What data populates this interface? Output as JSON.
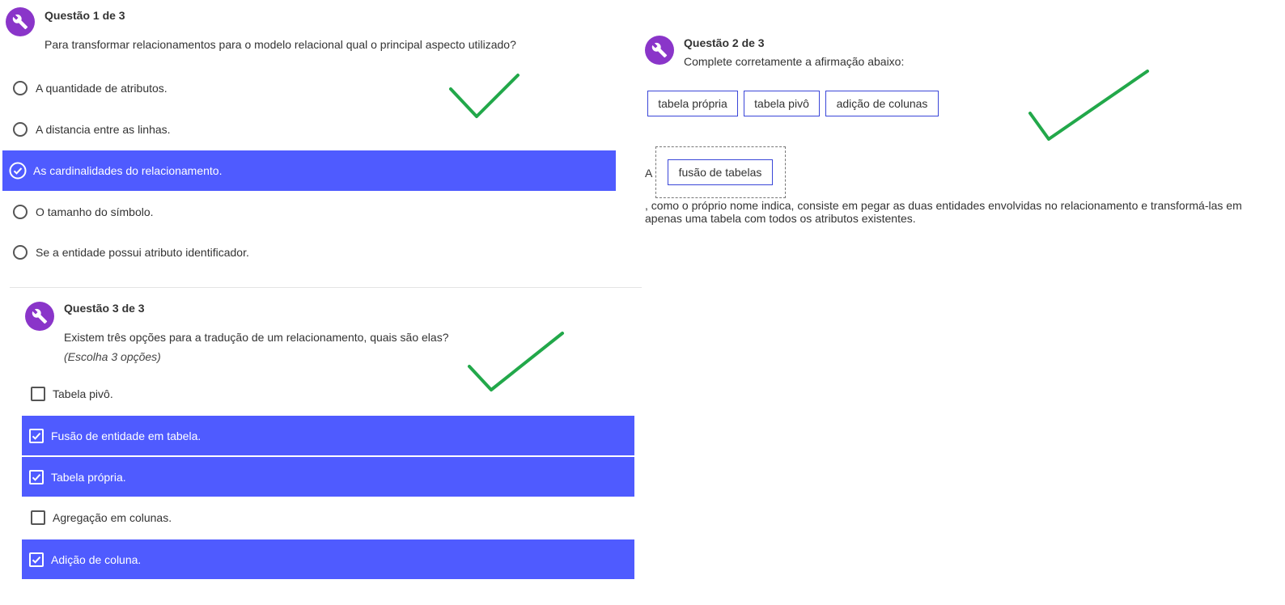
{
  "q1": {
    "title": "Questão 1 de 3",
    "text": "Para transformar relacionamentos para o modelo relacional qual o principal aspecto utilizado?",
    "options": [
      {
        "label": "A quantidade de atributos.",
        "selected": false
      },
      {
        "label": "A distancia entre as linhas.",
        "selected": false
      },
      {
        "label": "As cardinalidades do relacionamento.",
        "selected": true
      },
      {
        "label": "O tamanho do símbolo.",
        "selected": false
      },
      {
        "label": "Se a entidade possui atributo identificador.",
        "selected": false
      }
    ]
  },
  "q2": {
    "title": "Questão 2 de 3",
    "text": "Complete corretamente a afirmação abaixo:",
    "chips": [
      "tabela própria",
      "tabela pivô",
      "adição de colunas"
    ],
    "prefix": "A",
    "dropped_chip": "fusão de tabelas",
    "continuation": ", como o próprio nome indica, consiste em pegar as duas entidades envolvidas no relacionamento e transformá-las em apenas uma tabela com todos os atributos existentes."
  },
  "q3": {
    "title": "Questão 3 de 3",
    "text": "Existem três opções para a tradução de um relacionamento, quais são elas?",
    "hint": "(Escolha 3 opções)",
    "options": [
      {
        "label": "Tabela pivô.",
        "checked": false
      },
      {
        "label": "Fusão de entidade em tabela.",
        "checked": true
      },
      {
        "label": "Tabela própria.",
        "checked": true
      },
      {
        "label": "Agregação em colunas.",
        "checked": false
      },
      {
        "label": "Adição de coluna.",
        "checked": true
      }
    ]
  },
  "colors": {
    "accent": "#4f5bff",
    "icon_bg": "#8a35c9",
    "checkmark_annotation": "#22a84a"
  },
  "icons": {
    "question_icon": "wrench-icon",
    "radio_checked": "check-circle-icon",
    "checkbox_checked": "checkbox-checked-icon"
  }
}
